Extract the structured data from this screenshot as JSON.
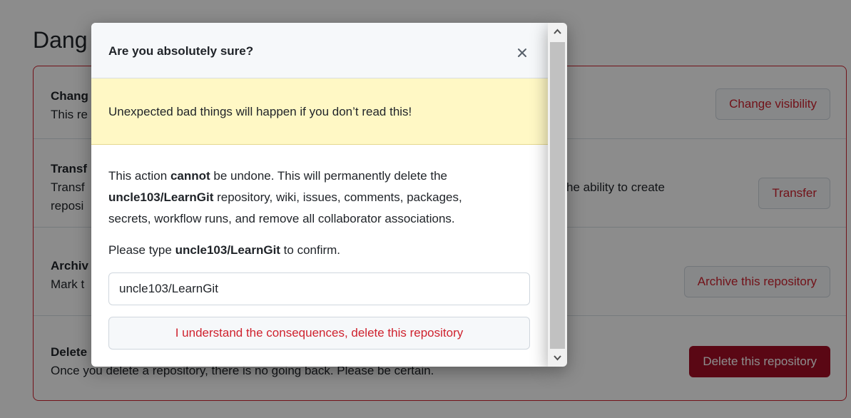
{
  "page": {
    "title": "Dang"
  },
  "rows": [
    {
      "title": "Chang",
      "desc": "This re",
      "button": "Change visibility"
    },
    {
      "title": "Transf",
      "desc": "Transf",
      "desc_right": "he ability to create",
      "desc2": "reposi",
      "button": "Transfer"
    },
    {
      "title": "Archiv",
      "desc": "Mark t",
      "button": "Archive this repository"
    },
    {
      "title": "Delete",
      "desc": "Once you delete a repository, there is no going back. Please be certain.",
      "button": "Delete this repository"
    }
  ],
  "modal": {
    "title": "Are you absolutely sure?",
    "close_icon": "close-icon",
    "warning": "Unexpected bad things will happen if you don’t read this!",
    "body": {
      "l1_a": "This action ",
      "l1_b": "cannot",
      "l1_c": " be undone. This will permanently delete the",
      "l2_a": "uncle103/LearnGit",
      "l2_b": " repository, wiki, issues, comments, packages,",
      "l3": "secrets, workflow runs, and remove all collaborator associations."
    },
    "confirm_prompt": {
      "a": "Please type ",
      "b": "uncle103/LearnGit",
      "c": " to confirm."
    },
    "input_value": "uncle103/LearnGit",
    "confirm_button": "I understand the consequences, delete this repository"
  },
  "colors": {
    "danger": "#cf222e",
    "danger_button_bg": "#a40e26",
    "warning_bg": "#fff8c5",
    "header_bg": "#f6f8fa"
  },
  "icons": {
    "scroll_up": "chevron-up-icon",
    "scroll_down": "chevron-down-icon"
  }
}
